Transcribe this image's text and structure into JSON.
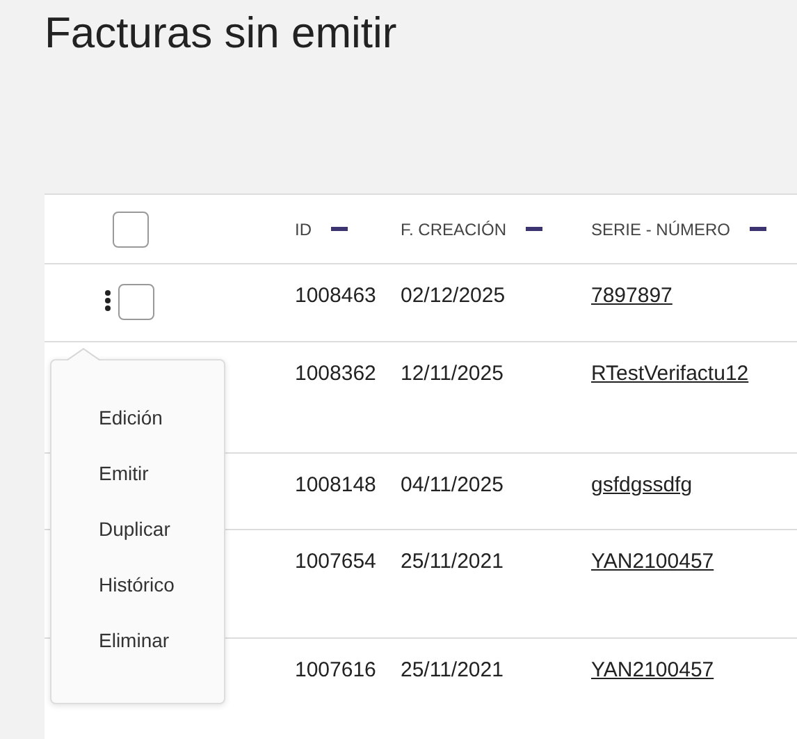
{
  "title": "Facturas sin emitir",
  "table": {
    "columns": [
      "ID",
      "F. CREACIÓN",
      "SERIE - NÚMERO"
    ],
    "header_checkbox": {
      "checked": false
    },
    "rows": [
      {
        "id": "1008463",
        "created": "02/12/2025",
        "serie": "7897897",
        "checked": false,
        "menu_button": true
      },
      {
        "id": "1008362",
        "created": "12/11/2025",
        "serie": "RTestVerifactu12"
      },
      {
        "id": "1008148",
        "created": "04/11/2025",
        "serie": "gsfdgssdfg"
      },
      {
        "id": "1007654",
        "created": "25/11/2021",
        "serie": "YAN2100457"
      },
      {
        "id": "1007616",
        "created": "25/11/2021",
        "serie": "YAN2100457"
      }
    ]
  },
  "context_menu": {
    "items": [
      "Edición",
      "Emitir",
      "Duplicar",
      "Histórico",
      "Eliminar"
    ]
  }
}
